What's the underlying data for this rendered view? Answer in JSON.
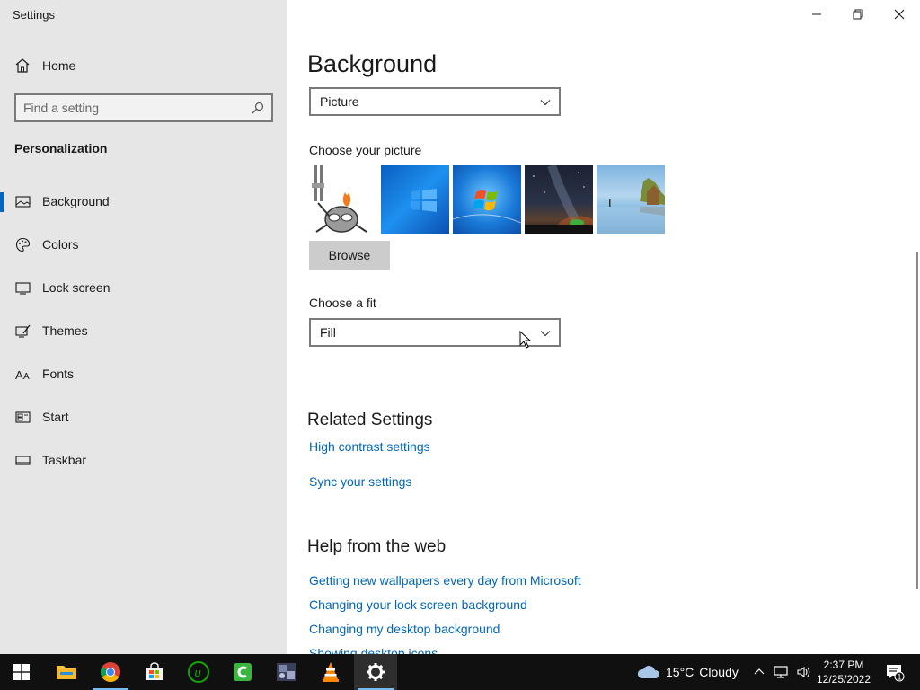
{
  "window": {
    "title": "Settings"
  },
  "sidebar": {
    "home_label": "Home",
    "search_placeholder": "Find a setting",
    "section_title": "Personalization",
    "items": [
      {
        "label": "Background",
        "icon": "picture-icon",
        "active": true
      },
      {
        "label": "Colors",
        "icon": "palette-icon",
        "active": false
      },
      {
        "label": "Lock screen",
        "icon": "lock-screen-icon",
        "active": false
      },
      {
        "label": "Themes",
        "icon": "themes-icon",
        "active": false
      },
      {
        "label": "Fonts",
        "icon": "fonts-icon",
        "active": false
      },
      {
        "label": "Start",
        "icon": "start-icon",
        "active": false
      },
      {
        "label": "Taskbar",
        "icon": "taskbar-icon",
        "active": false
      }
    ]
  },
  "main": {
    "title": "Background",
    "background_type": "Picture",
    "choose_picture_label": "Choose your picture",
    "browse_label": "Browse",
    "choose_fit_label": "Choose a fit",
    "fit_value": "Fill",
    "related_title": "Related Settings",
    "related_links": [
      "High contrast settings",
      "Sync your settings"
    ],
    "help_title": "Help from the web",
    "help_links": [
      "Getting new wallpapers every day from Microsoft",
      "Changing your lock screen background",
      "Changing my desktop background",
      "Showing desktop icons"
    ]
  },
  "taskbar": {
    "weather_temp": "15°C",
    "weather_text": "Cloudy",
    "time": "2:37 PM",
    "date": "12/25/2022",
    "notification_count": "1",
    "accent": "#76b9ed"
  }
}
